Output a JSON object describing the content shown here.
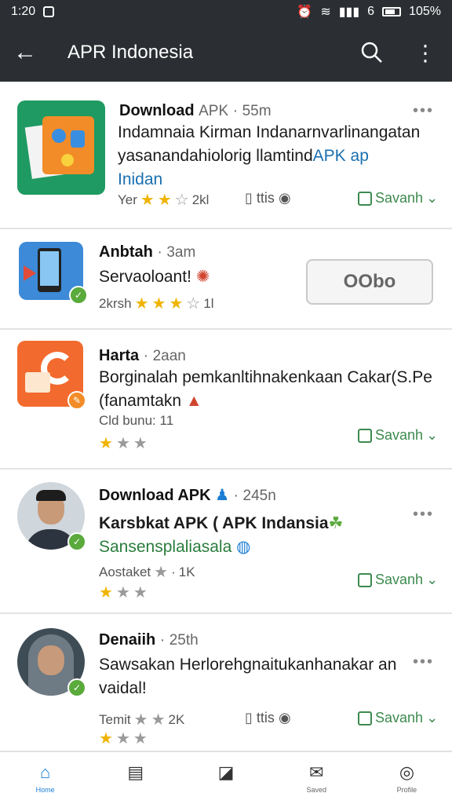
{
  "status_bar": {
    "time": "1:20",
    "signal_label": "6",
    "battery": "105%"
  },
  "app_bar": {
    "title": "APR Indonesia"
  },
  "posts": [
    {
      "name": "Download",
      "name_suffix": "APK",
      "time": "55m",
      "desc_line1": "Indamnaia Kirman Indanarnvarlinangatan",
      "desc_line2_pre": "yasanandahiolorig llamtind",
      "desc_line2_link": "APK ap",
      "desc_line3": "Inidan",
      "meta_left": "Yer",
      "meta_count": "2kl",
      "meta_mid": "ttis",
      "save": "Savanh"
    },
    {
      "name": "Anbtah",
      "time": "3am",
      "desc_line1": "Servaoloant!",
      "meta_left": "2krsh",
      "meta_count": "1l",
      "button": "OObo"
    },
    {
      "name": "Harta",
      "time": "2aan",
      "desc_line1": "Borginalah pemkanltihnakenkaan Cakar(S.Pe",
      "desc_line2": "(fanamtakn",
      "meta_left": "Cld bunu: 11",
      "save": "Savanh"
    },
    {
      "name": "Download APK",
      "time": "245n",
      "desc_line1": "Karsbkat APK ( APK Indansia",
      "desc_line2": "Sansensplaliasala",
      "meta_left": "Aostaket",
      "meta_count": "1K",
      "save": "Savanh"
    },
    {
      "name": "Denaiih",
      "time": "25th",
      "desc_line1": "Sawsakan Herlorehgnaitukanhanakar an",
      "desc_line2": "vaidal!",
      "meta_left": "Temit",
      "meta_count": "2K",
      "meta_mid": "ttis",
      "save": "Savanh"
    }
  ],
  "bottom_nav": [
    {
      "label": "Home",
      "icon": "home-icon",
      "active": true
    },
    {
      "label": "",
      "icon": "inbox-icon",
      "active": false
    },
    {
      "label": "",
      "icon": "edit-icon",
      "active": false
    },
    {
      "label": "Saved",
      "icon": "mail-icon",
      "active": false
    },
    {
      "label": "Profile",
      "icon": "compass-icon",
      "active": false
    }
  ],
  "colors": {
    "appbar": "#2b2f33",
    "accent": "#1b7ed3",
    "green": "#3d8a4f",
    "star": "#f0b400"
  }
}
